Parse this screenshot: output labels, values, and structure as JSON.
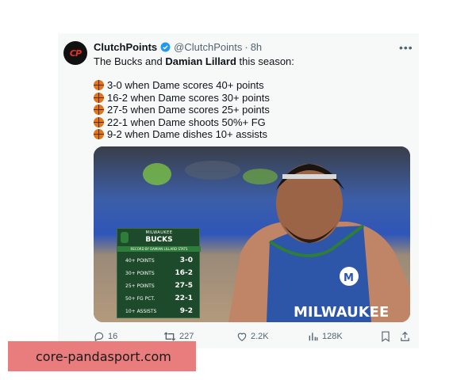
{
  "post": {
    "display_name": "ClutchPoints",
    "handle": "@ClutchPoints",
    "separator": "·",
    "time": "8h",
    "intro_prefix": "The Bucks and ",
    "intro_bold": "Damian Lillard",
    "intro_suffix": " this season:",
    "stats": [
      "3-0 when Dame scores 40+ points",
      "16-2 when Dame scores 30+ points",
      "27-5 when Dame scores 25+ points",
      "22-1 when Dame shoots 50%+ FG",
      "9-2 when Dame dishes 10+ assists"
    ],
    "icons": {
      "avatar": "clutchpoints-logo",
      "verified": "verified-badge-icon",
      "stat": "basketball-icon"
    }
  },
  "graphic": {
    "team_city": "MILWAUKEE",
    "team_name": "BUCKS",
    "subtitle": "RECORD BY DAMIAN LILLARD STATS",
    "rows": [
      {
        "label": "40+ POINTS",
        "value": "3-0"
      },
      {
        "label": "30+ POINTS",
        "value": "16-2"
      },
      {
        "label": "25+ POINTS",
        "value": "27-5"
      },
      {
        "label": "50+ FG PCT.",
        "value": "22-1"
      },
      {
        "label": "10+ ASSISTS",
        "value": "9-2"
      }
    ],
    "jersey_text": "MILWAUKEE",
    "colors": {
      "jersey": "#2d55a8",
      "board": "#1c4a2a",
      "accent": "#2e7d3a"
    }
  },
  "actions": {
    "replies": "16",
    "reposts": "227",
    "likes": "2.2K",
    "views": "128K"
  },
  "watermark": "core-pandasport.com"
}
